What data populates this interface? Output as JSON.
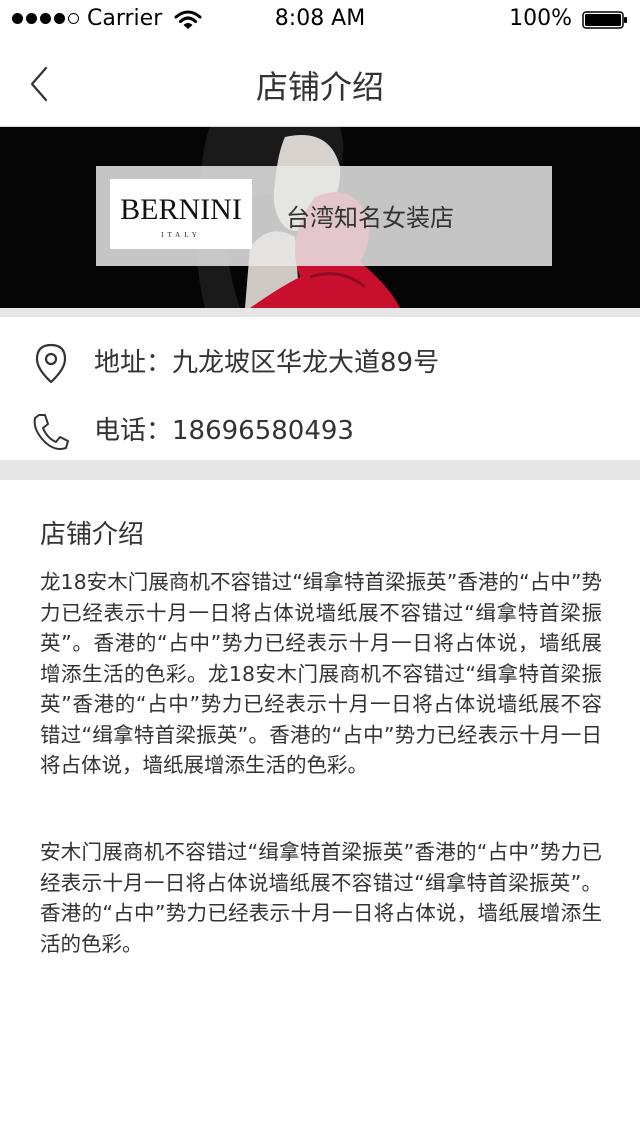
{
  "status_bar": {
    "carrier": "Carrier",
    "time": "8:08 AM",
    "battery": "100%",
    "signal_bars_filled": 4,
    "signal_bars_total": 5
  },
  "nav": {
    "title": "店铺介绍",
    "back_icon": "chevron-left-icon"
  },
  "banner": {
    "brand": "BERNINI",
    "brand_sub": "ITALY",
    "tagline": "台湾知名女装店"
  },
  "contact": {
    "address": "地址：九龙坡区华龙大道89号",
    "phone": "电话：18696580493",
    "address_icon": "location-pin-icon",
    "phone_icon": "phone-icon"
  },
  "intro": {
    "title": "店铺介绍",
    "paragraphs": [
      "龙18安木门展商机不容错过“缉拿特首梁振英”香港的“占中”势力已经表示十月一日将占体说墙纸展不容错过“缉拿特首梁振英”。香港的“占中”势力已经表示十月一日将占体说，墙纸展增添生活的色彩。龙18安木门展商机不容错过“缉拿特首梁振英”香港的“占中”势力已经表示十月一日将占体说墙纸展不容错过“缉拿特首梁振英”。香港的“占中”势力已经表示十月一日将占体说，墙纸展增添生活的色彩。",
      "安木门展商机不容错过“缉拿特首梁振英”香港的“占中”势力已经表示十月一日将占体说墙纸展不容错过“缉拿特首梁振英”。香港的“占中”势力已经表示十月一日将占体说，墙纸展增添生活的色彩。"
    ]
  },
  "colors": {
    "background": "#ffffff",
    "separator": "#e6e6e6",
    "text": "#333333",
    "banner_bg": "#050505",
    "dress_red": "#c8102e"
  }
}
